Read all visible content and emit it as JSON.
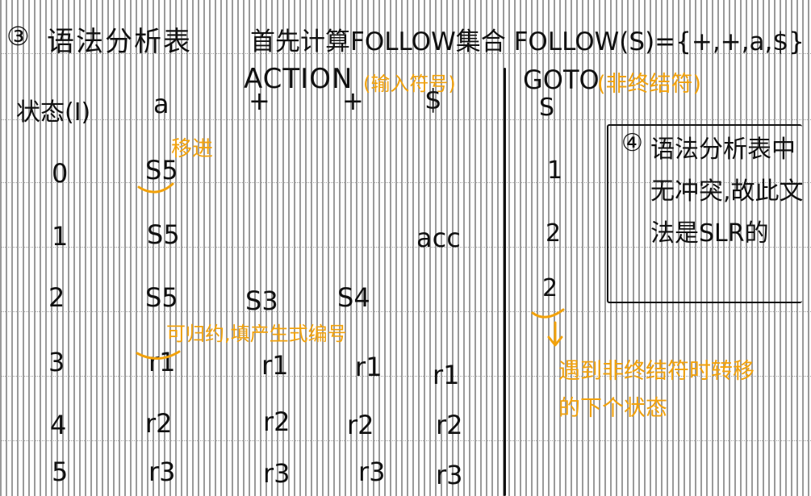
{
  "heading": {
    "number": "③",
    "title": "语法分析表",
    "note": "首先计算FOLLOW集合 FOLLOW(S)={+,+,a,$}"
  },
  "action": {
    "label": "ACTION",
    "annotation": "(输入符号)"
  },
  "goto": {
    "label": "GOTO",
    "annotation": "(非终结符)"
  },
  "table": {
    "state_header": "状态(I)",
    "columns": [
      "a",
      "+",
      "+",
      "$",
      "S"
    ],
    "rows": [
      {
        "state": "0",
        "a": "S5",
        "plus": "",
        "x": "",
        "dollar": "",
        "goto": "1"
      },
      {
        "state": "1",
        "a": "S5",
        "plus": "",
        "x": "",
        "dollar": "acc",
        "goto": "2"
      },
      {
        "state": "2",
        "a": "S5",
        "plus": "S3",
        "x": "S4",
        "dollar": "",
        "goto": "2"
      },
      {
        "state": "3",
        "a": "r1",
        "plus": "r1",
        "x": "r1",
        "dollar": "r1",
        "goto": ""
      },
      {
        "state": "4",
        "a": "r2",
        "plus": "r2",
        "x": "r2",
        "dollar": "r2",
        "goto": ""
      },
      {
        "state": "5",
        "a": "r3",
        "plus": "r3",
        "x": "r3",
        "dollar": "r3",
        "goto": ""
      }
    ]
  },
  "annotations": {
    "shift": "移进",
    "reduce": "可归约,填产生式编号",
    "goto_note_line1": "遇到非终结符时转移",
    "goto_note_line2": "的下个状态"
  },
  "conclusion": {
    "number": "④",
    "text": "语法分析表中无冲突,故此文法是SLR的"
  },
  "colors": {
    "ink": "#111111",
    "annotation": "#f2a20c",
    "rule": "#9a9a9a"
  }
}
